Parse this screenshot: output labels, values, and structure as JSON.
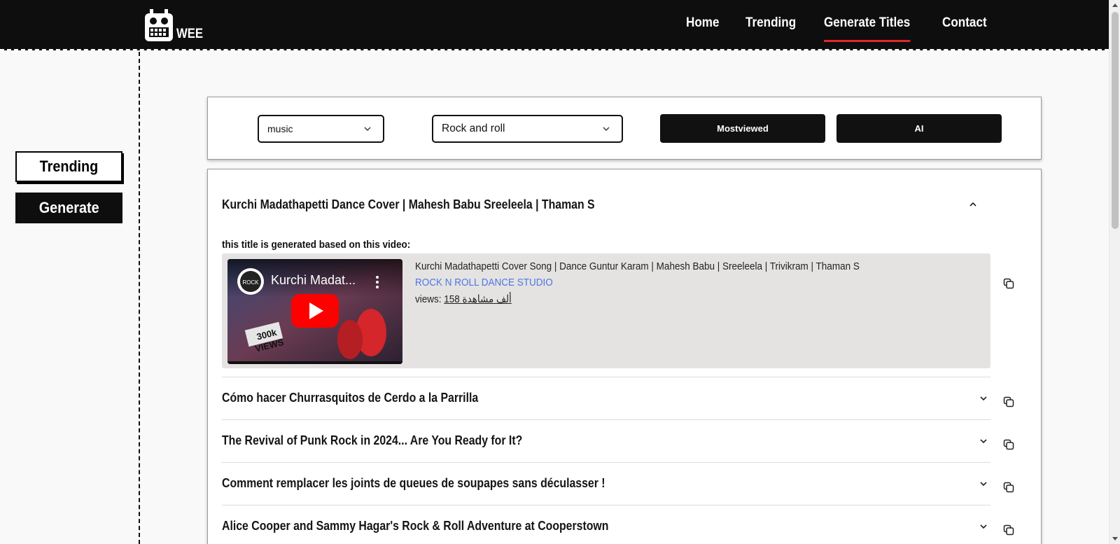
{
  "brand": {
    "name": "WEE",
    "logo_icon": "robot-icon"
  },
  "nav": {
    "items": [
      {
        "label": "Home",
        "active": false
      },
      {
        "label": "Trending",
        "active": false
      },
      {
        "label": "Generate Titles",
        "active": true
      },
      {
        "label": "Contact",
        "active": false
      }
    ],
    "active_color": "#e3262b"
  },
  "sidebar": {
    "trending_label": "Trending",
    "generate_label": "Generate"
  },
  "filters": {
    "category": "music",
    "genre": "Rock and roll",
    "mostviewed_label": "Mostviewed",
    "ai_label": "AI"
  },
  "titles": {
    "expanded": {
      "title": "Kurchi Madathapetti Dance Cover | Mahesh Babu Sreeleela | Thaman S",
      "based_on_label": "this title is generated based on this video:",
      "video": {
        "thumbnail_title": "Kurchi Madat...",
        "thumbnail_badge": "300k VIEWS",
        "title": "Kurchi Madathapetti Cover Song | Dance Guntur Karam | Mahesh Babu | Sreeleela | Trivikram | Thaman S",
        "channel": "ROCK N ROLL DANCE STUDIO",
        "views_label": "views:",
        "views_value": "158 ألف مشاهدة"
      }
    },
    "collapsed": [
      {
        "title": "Cómo hacer Churrasquitos de Cerdo a la Parrilla"
      },
      {
        "title": "The Revival of Punk Rock in 2024... Are You Ready for It?"
      },
      {
        "title": "Comment remplacer les joints de queues de soupapes sans déculasser !"
      },
      {
        "title": "Alice Cooper and Sammy Hagar's Rock & Roll Adventure at Cooperstown"
      }
    ]
  },
  "colors": {
    "link": "#5075e6",
    "dark": "#111111",
    "video_box_bg": "#e4e3e1"
  }
}
